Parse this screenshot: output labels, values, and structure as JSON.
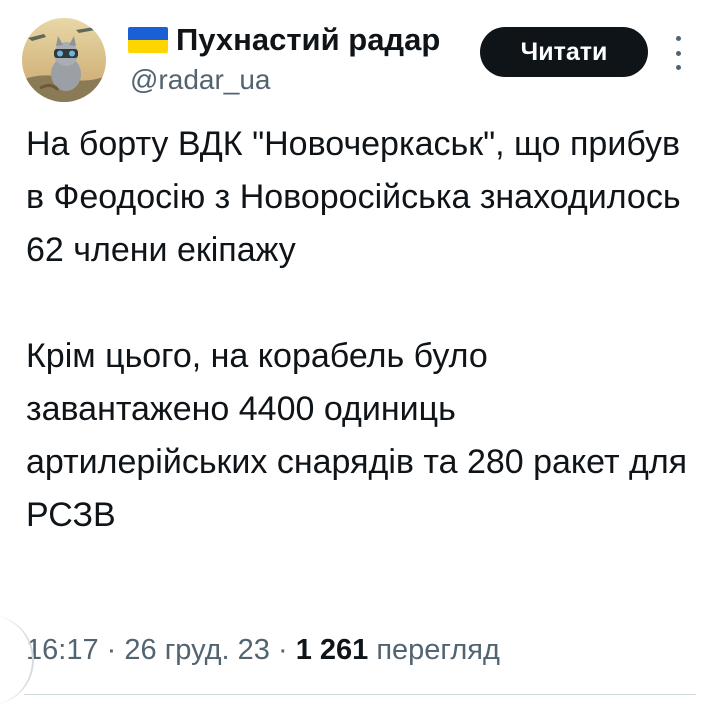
{
  "author": {
    "display_name": "Пухнастий радар",
    "handle": "@radar_ua"
  },
  "follow_label": "Читати",
  "tweet": {
    "paragraph_1": "На борту ВДК \"Новочеркаськ\", що прибув в Феодосію з Новоросійська знаходилось 62 члени екіпажу",
    "paragraph_2": "Крім цього, на корабель було завантажено 4400 одиниць артилерійських снарядів та 280 ракет для РСЗВ"
  },
  "meta": {
    "time": "16:17",
    "date": "26 груд. 23",
    "separator": "·",
    "views_count": "1 261",
    "views_label": "перегляд"
  },
  "colors": {
    "text": "#0f1419",
    "secondary": "#536471",
    "button_bg": "#0f1419",
    "flag_blue": "#1a5fd6",
    "flag_yellow": "#ffd500"
  }
}
